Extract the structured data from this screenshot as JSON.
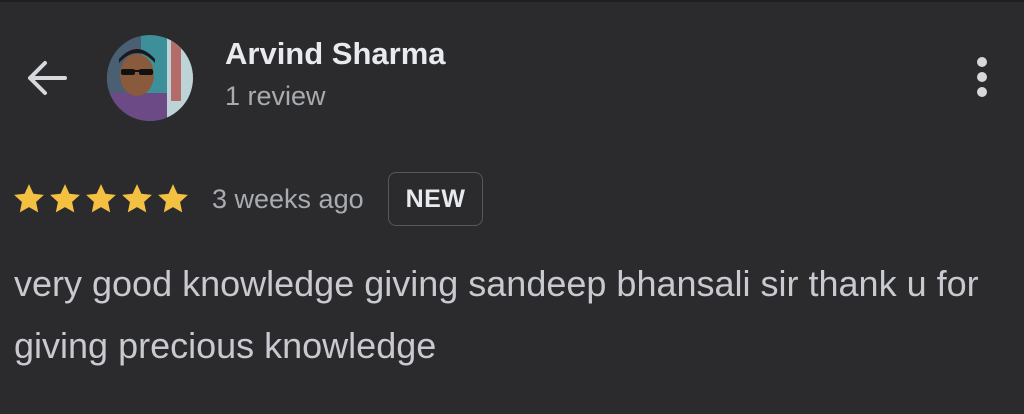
{
  "header": {
    "reviewer_name": "Arvind Sharma",
    "review_count": "1 review",
    "icons": {
      "back": "arrow-back-icon",
      "more": "more-vertical-icon"
    }
  },
  "review": {
    "rating": 5,
    "max_rating": 5,
    "timestamp": "3 weeks ago",
    "badge": "NEW",
    "text": "very good knowledge giving sandeep bhansali sir thank u for giving precious knowledge"
  },
  "colors": {
    "background": "#2b2b2e",
    "star": "#f4c042",
    "primary_text": "#e8eaed",
    "secondary_text": "#a8abb0"
  }
}
